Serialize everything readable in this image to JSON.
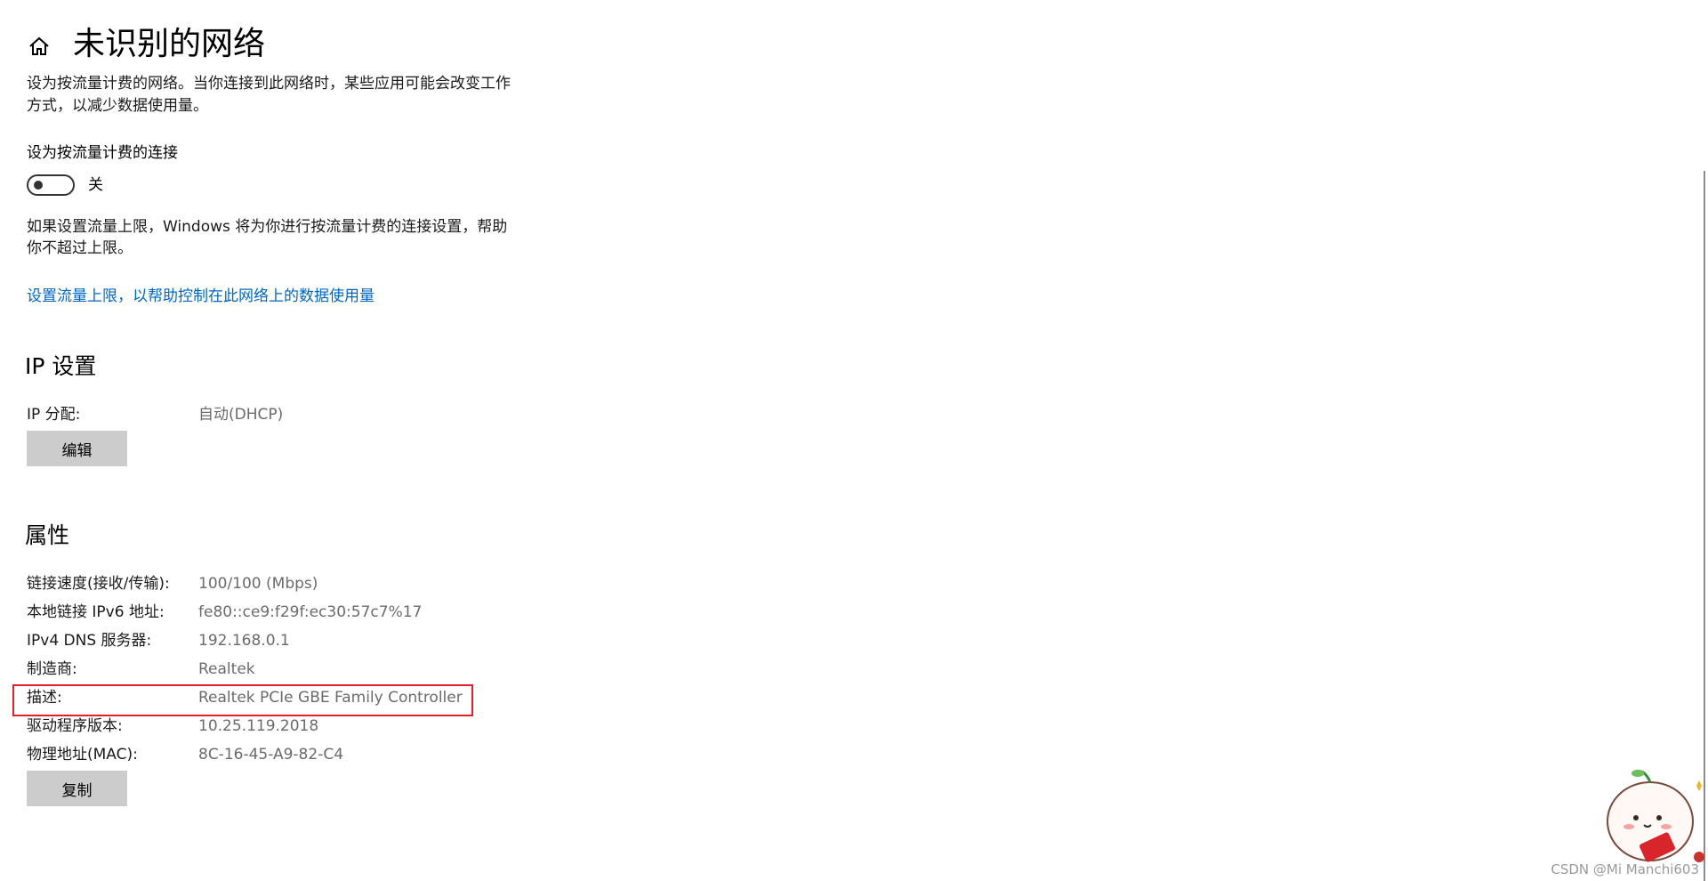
{
  "header": {
    "home_icon": "home-icon",
    "title": "未识别的网络"
  },
  "metered": {
    "description_line1": "设为按流量计费的网络。当你连接到此网络时，某些应用可能会改变工作",
    "description_line2": "方式，以减少数据使用量。",
    "toggle_label": "设为按流量计费的连接",
    "toggle_state": "关",
    "toggle_on": false,
    "limit_note_line1": "如果设置流量上限，Windows 将为你进行按流量计费的连接设置，帮助",
    "limit_note_line2": "你不超过上限。",
    "limit_link": "设置流量上限，以帮助控制在此网络上的数据使用量"
  },
  "ip_settings": {
    "title": "IP 设置",
    "assignment_label": "IP 分配:",
    "assignment_value": "自动(DHCP)",
    "edit_button": "编辑"
  },
  "properties": {
    "title": "属性",
    "rows": [
      {
        "label": "链接速度(接收/传输):",
        "value": "100/100 (Mbps)"
      },
      {
        "label": "本地链接 IPv6 地址:",
        "value": "fe80::ce9:f29f:ec30:57c7%17"
      },
      {
        "label": "IPv4 DNS 服务器:",
        "value": "192.168.0.1"
      },
      {
        "label": "制造商:",
        "value": "Realtek"
      },
      {
        "label": "描述:",
        "value": "Realtek PCIe GBE Family Controller"
      },
      {
        "label": "驱动程序版本:",
        "value": "10.25.119.2018"
      },
      {
        "label": "物理地址(MAC):",
        "value": "8C-16-45-A9-82-C4"
      }
    ],
    "copy_button": "复制"
  },
  "annotation": {
    "highlight_color": "#e0202a"
  },
  "watermark": "CSDN @Mi Manchi603",
  "colors": {
    "link": "#0067c0",
    "value_text": "#6b6b6b",
    "button_bg": "#cccccc"
  }
}
